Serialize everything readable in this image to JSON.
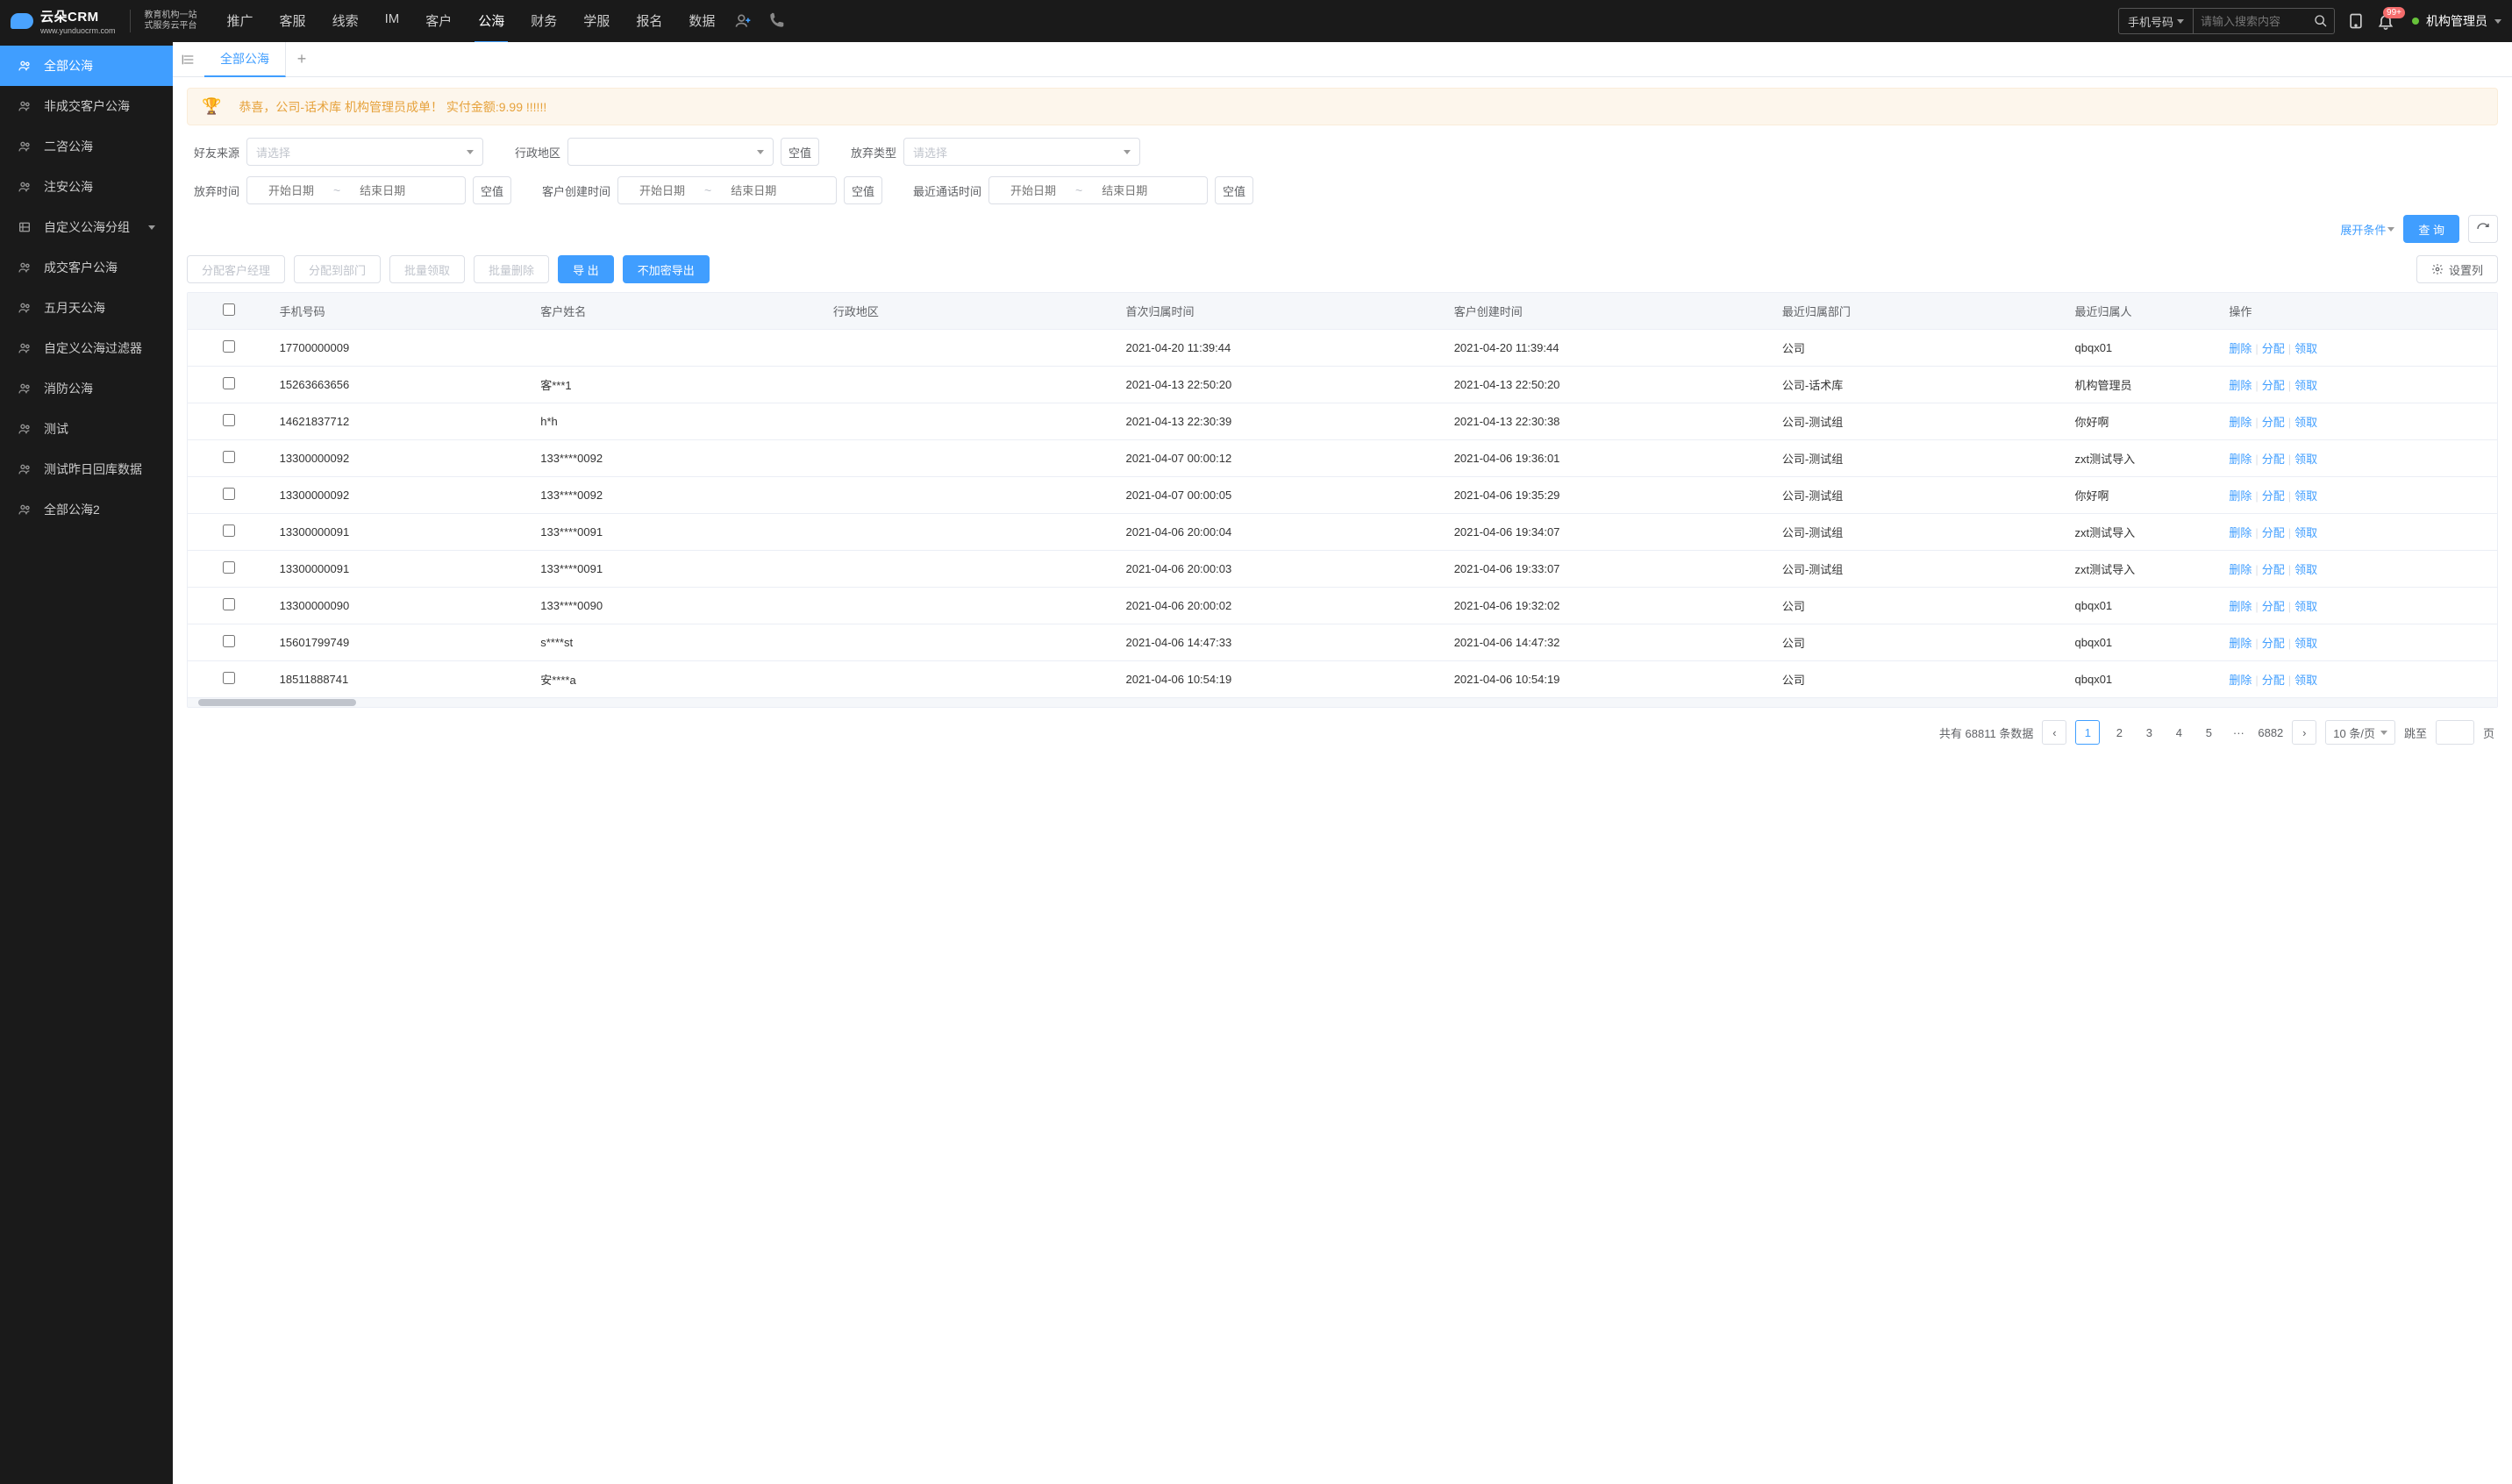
{
  "header": {
    "logo": "云朵CRM",
    "logo_url": "www.yunduocrm.com",
    "logo_sub1": "教育机构一站",
    "logo_sub2": "式服务云平台",
    "nav": [
      "推广",
      "客服",
      "线索",
      "IM",
      "客户",
      "公海",
      "财务",
      "学服",
      "报名",
      "数据"
    ],
    "active_nav_index": 5,
    "search_type": "手机号码",
    "search_placeholder": "请输入搜索内容",
    "badge": "99+",
    "user_name": "机构管理员"
  },
  "sidebar": {
    "items": [
      {
        "label": "全部公海",
        "icon": "users",
        "active": true
      },
      {
        "label": "非成交客户公海",
        "icon": "users"
      },
      {
        "label": "二咨公海",
        "icon": "users"
      },
      {
        "label": "注安公海",
        "icon": "users"
      },
      {
        "label": "自定义公海分组",
        "icon": "folder",
        "chevron": true
      },
      {
        "label": "成交客户公海",
        "icon": "users"
      },
      {
        "label": "五月天公海",
        "icon": "users"
      },
      {
        "label": "自定义公海过滤器",
        "icon": "users"
      },
      {
        "label": "消防公海",
        "icon": "users"
      },
      {
        "label": "测试",
        "icon": "users"
      },
      {
        "label": "测试昨日回库数据",
        "icon": "users"
      },
      {
        "label": "全部公海2",
        "icon": "users"
      }
    ]
  },
  "tabs": {
    "items": [
      "全部公海"
    ],
    "active_index": 0
  },
  "congrats": "恭喜，公司-话术库  机构管理员成单！  实付金额:9.99 !!!!!!",
  "filters": {
    "source_label": "好友来源",
    "source_placeholder": "请选择",
    "region_label": "行政地区",
    "region_empty": "空值",
    "abandon_type_label": "放弃类型",
    "abandon_type_placeholder": "请选择",
    "abandon_time_label": "放弃时间",
    "create_time_label": "客户创建时间",
    "recent_call_label": "最近通话时间",
    "date_start_placeholder": "开始日期",
    "date_end_placeholder": "结束日期",
    "date_empty": "空值",
    "expand": "展开条件",
    "query": "查 询"
  },
  "actions": {
    "assign_manager": "分配客户经理",
    "assign_dept": "分配到部门",
    "batch_claim": "批量领取",
    "batch_delete": "批量删除",
    "export": "导 出",
    "export_plain": "不加密导出",
    "set_columns": "设置列"
  },
  "table": {
    "headers": {
      "phone": "手机号码",
      "name": "客户姓名",
      "region": "行政地区",
      "first_belong_time": "首次归属时间",
      "create_time": "客户创建时间",
      "recent_dept": "最近归属部门",
      "recent_person": "最近归属人",
      "ops": "操作"
    },
    "ops": {
      "delete": "删除",
      "assign": "分配",
      "claim": "领取"
    },
    "rows": [
      {
        "phone": "17700000009",
        "name": "",
        "region": "",
        "first_time": "2021-04-20 11:39:44",
        "create_time": "2021-04-20 11:39:44",
        "dept": "公司",
        "person": "qbqx01"
      },
      {
        "phone": "15263663656",
        "name": "客***1",
        "region": "",
        "first_time": "2021-04-13 22:50:20",
        "create_time": "2021-04-13 22:50:20",
        "dept": "公司-话术库",
        "person": "机构管理员"
      },
      {
        "phone": "14621837712",
        "name": "h*h",
        "region": "",
        "first_time": "2021-04-13 22:30:39",
        "create_time": "2021-04-13 22:30:38",
        "dept": "公司-测试组",
        "person": "你好啊"
      },
      {
        "phone": "13300000092",
        "name": "133****0092",
        "region": "",
        "first_time": "2021-04-07 00:00:12",
        "create_time": "2021-04-06 19:36:01",
        "dept": "公司-测试组",
        "person": "zxt测试导入"
      },
      {
        "phone": "13300000092",
        "name": "133****0092",
        "region": "",
        "first_time": "2021-04-07 00:00:05",
        "create_time": "2021-04-06 19:35:29",
        "dept": "公司-测试组",
        "person": "你好啊"
      },
      {
        "phone": "13300000091",
        "name": "133****0091",
        "region": "",
        "first_time": "2021-04-06 20:00:04",
        "create_time": "2021-04-06 19:34:07",
        "dept": "公司-测试组",
        "person": "zxt测试导入"
      },
      {
        "phone": "13300000091",
        "name": "133****0091",
        "region": "",
        "first_time": "2021-04-06 20:00:03",
        "create_time": "2021-04-06 19:33:07",
        "dept": "公司-测试组",
        "person": "zxt测试导入"
      },
      {
        "phone": "13300000090",
        "name": "133****0090",
        "region": "",
        "first_time": "2021-04-06 20:00:02",
        "create_time": "2021-04-06 19:32:02",
        "dept": "公司",
        "person": "qbqx01"
      },
      {
        "phone": "15601799749",
        "name": "s****st",
        "region": "",
        "first_time": "2021-04-06 14:47:33",
        "create_time": "2021-04-06 14:47:32",
        "dept": "公司",
        "person": "qbqx01"
      },
      {
        "phone": "18511888741",
        "name": "安****a",
        "region": "",
        "first_time": "2021-04-06 10:54:19",
        "create_time": "2021-04-06 10:54:19",
        "dept": "公司",
        "person": "qbqx01"
      }
    ]
  },
  "pagination": {
    "total_prefix": "共有",
    "total": "68811",
    "total_suffix": "条数据",
    "pages": [
      "1",
      "2",
      "3",
      "4",
      "5"
    ],
    "ellipsis": "···",
    "last_page": "6882",
    "per_page": "10 条/页",
    "jump_label": "跳至",
    "page_suffix": "页"
  }
}
